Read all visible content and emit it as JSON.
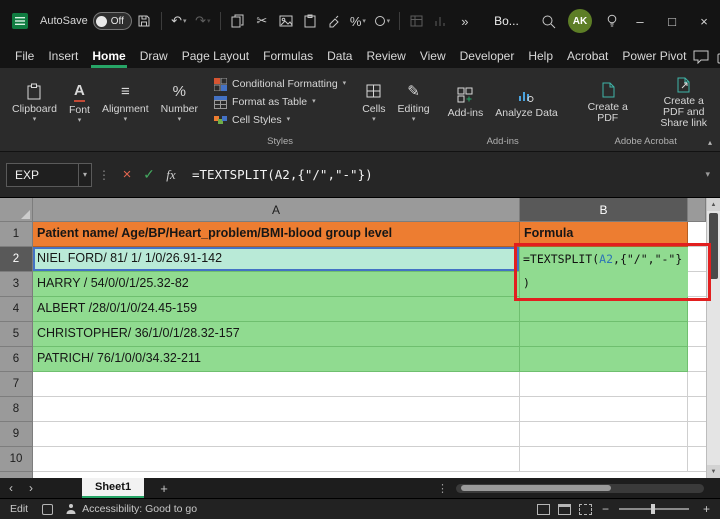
{
  "window": {
    "autosave_label": "AutoSave",
    "autosave_state": "Off",
    "workbook_title": "Bo...",
    "avatar_initials": "AK"
  },
  "ribbon": {
    "tabs": [
      "File",
      "Insert",
      "Home",
      "Draw",
      "Page Layout",
      "Formulas",
      "Data",
      "Review",
      "View",
      "Developer",
      "Help",
      "Acrobat",
      "Power Pivot"
    ],
    "active_tab": "Home",
    "buttons": {
      "clipboard": "Clipboard",
      "font": "Font",
      "alignment": "Alignment",
      "number": "Number",
      "conditional_formatting": "Conditional Formatting",
      "format_as_table": "Format as Table",
      "cell_styles": "Cell Styles",
      "cells": "Cells",
      "editing": "Editing",
      "add_ins": "Add-ins",
      "analyze_data": "Analyze Data",
      "create_pdf": "Create a PDF",
      "create_pdf_share": "Create a PDF and Share link"
    },
    "group_labels": {
      "styles": "Styles",
      "add_ins": "Add-ins",
      "acrobat": "Adobe Acrobat"
    }
  },
  "formula_bar": {
    "name_box": "EXP",
    "fx_label": "fx",
    "formula": "=TEXTSPLIT(A2,{\"/\",\"-\"})"
  },
  "grid": {
    "col_a": "A",
    "col_b": "B",
    "rows": [
      "1",
      "2",
      "3",
      "4",
      "5",
      "6",
      "7",
      "8",
      "9",
      "10"
    ],
    "a1": "Patient name/ Age/BP/Heart_problem/BMI-blood group level",
    "b1": "Formula",
    "a2": "NIEL FORD/ 81/ 1/ 1/0/26.91-142",
    "a3": "HARRY / 54/0/0/1/25.32-82",
    "a4": "ALBERT /28/0/1/0/24.45-159",
    "a5": "CHRISTOPHER/ 36/1/0/1/28.32-157",
    "a6": "PATRICH/ 76/1/0/0/34.32-211",
    "edit": {
      "pre": "=TEXTSPLIT(",
      "ref": "A2",
      "post": ",{\"/\",\"-\"}",
      "line2": ")"
    }
  },
  "sheet_bar": {
    "sheet1": "Sheet1"
  },
  "status_bar": {
    "mode": "Edit",
    "accessibility": "Accessibility: Good to go"
  },
  "colors": {
    "accent_green": "#27A567",
    "header_orange": "#ED7D31",
    "cell_green": "#90DB90",
    "annotation_red": "#E21F1F",
    "reference_blue": "#4472C4"
  }
}
